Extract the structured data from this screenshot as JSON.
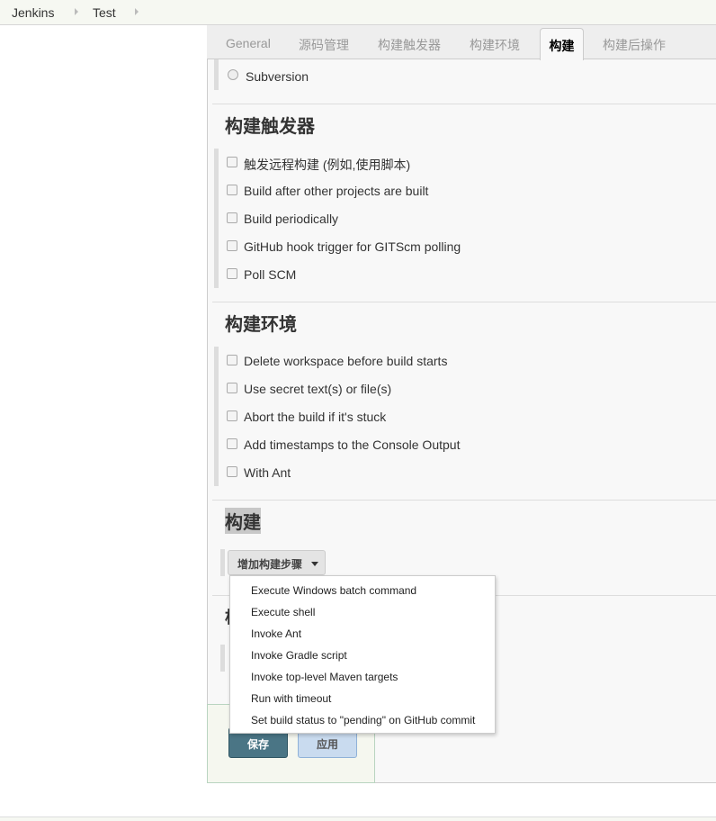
{
  "breadcrumb": [
    "Jenkins",
    "Test"
  ],
  "tabs": [
    "General",
    "源码管理",
    "构建触发器",
    "构建环境",
    "构建",
    "构建后操作"
  ],
  "scm": {
    "option": "Subversion"
  },
  "triggers": {
    "heading": "构建触发器",
    "items": [
      "触发远程构建 (例如,使用脚本)",
      "Build after other projects are built",
      "Build periodically",
      "GitHub hook trigger for GITScm polling",
      "Poll SCM"
    ]
  },
  "env": {
    "heading": "构建环境",
    "items": [
      "Delete workspace before build starts",
      "Use secret text(s) or file(s)",
      "Abort the build if it's stuck",
      "Add timestamps to the Console Output",
      "With Ant"
    ]
  },
  "build": {
    "heading": "构建",
    "add_step": "增加构建步骤",
    "menu": [
      "Execute Windows batch command",
      "Execute shell",
      "Invoke Ant",
      "Invoke Gradle script",
      "Invoke top-level Maven targets",
      "Run with timeout",
      "Set build status to \"pending\" on GitHub commit"
    ]
  },
  "post": {
    "heading_partial": "构"
  },
  "actions": {
    "save": "保存",
    "apply": "应用"
  },
  "colors": {
    "save": "#4a7585",
    "apply": "#c9dbef"
  }
}
